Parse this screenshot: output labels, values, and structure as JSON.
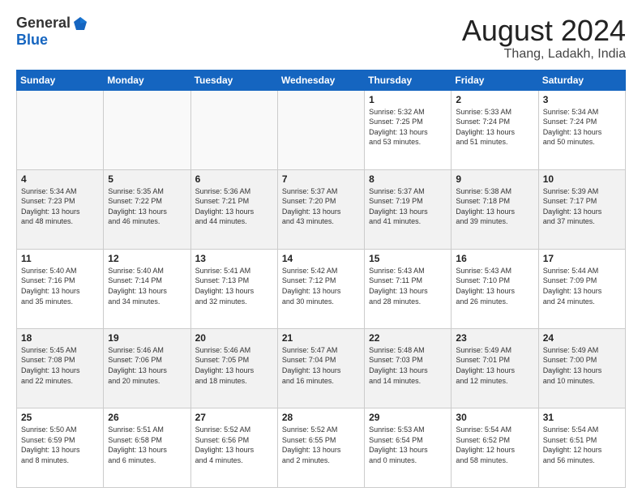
{
  "header": {
    "logo_general": "General",
    "logo_blue": "Blue",
    "month_title": "August 2024",
    "location": "Thang, Ladakh, India"
  },
  "weekdays": [
    "Sunday",
    "Monday",
    "Tuesday",
    "Wednesday",
    "Thursday",
    "Friday",
    "Saturday"
  ],
  "weeks": [
    [
      {
        "day": "",
        "info": ""
      },
      {
        "day": "",
        "info": ""
      },
      {
        "day": "",
        "info": ""
      },
      {
        "day": "",
        "info": ""
      },
      {
        "day": "1",
        "info": "Sunrise: 5:32 AM\nSunset: 7:25 PM\nDaylight: 13 hours\nand 53 minutes."
      },
      {
        "day": "2",
        "info": "Sunrise: 5:33 AM\nSunset: 7:24 PM\nDaylight: 13 hours\nand 51 minutes."
      },
      {
        "day": "3",
        "info": "Sunrise: 5:34 AM\nSunset: 7:24 PM\nDaylight: 13 hours\nand 50 minutes."
      }
    ],
    [
      {
        "day": "4",
        "info": "Sunrise: 5:34 AM\nSunset: 7:23 PM\nDaylight: 13 hours\nand 48 minutes."
      },
      {
        "day": "5",
        "info": "Sunrise: 5:35 AM\nSunset: 7:22 PM\nDaylight: 13 hours\nand 46 minutes."
      },
      {
        "day": "6",
        "info": "Sunrise: 5:36 AM\nSunset: 7:21 PM\nDaylight: 13 hours\nand 44 minutes."
      },
      {
        "day": "7",
        "info": "Sunrise: 5:37 AM\nSunset: 7:20 PM\nDaylight: 13 hours\nand 43 minutes."
      },
      {
        "day": "8",
        "info": "Sunrise: 5:37 AM\nSunset: 7:19 PM\nDaylight: 13 hours\nand 41 minutes."
      },
      {
        "day": "9",
        "info": "Sunrise: 5:38 AM\nSunset: 7:18 PM\nDaylight: 13 hours\nand 39 minutes."
      },
      {
        "day": "10",
        "info": "Sunrise: 5:39 AM\nSunset: 7:17 PM\nDaylight: 13 hours\nand 37 minutes."
      }
    ],
    [
      {
        "day": "11",
        "info": "Sunrise: 5:40 AM\nSunset: 7:16 PM\nDaylight: 13 hours\nand 35 minutes."
      },
      {
        "day": "12",
        "info": "Sunrise: 5:40 AM\nSunset: 7:14 PM\nDaylight: 13 hours\nand 34 minutes."
      },
      {
        "day": "13",
        "info": "Sunrise: 5:41 AM\nSunset: 7:13 PM\nDaylight: 13 hours\nand 32 minutes."
      },
      {
        "day": "14",
        "info": "Sunrise: 5:42 AM\nSunset: 7:12 PM\nDaylight: 13 hours\nand 30 minutes."
      },
      {
        "day": "15",
        "info": "Sunrise: 5:43 AM\nSunset: 7:11 PM\nDaylight: 13 hours\nand 28 minutes."
      },
      {
        "day": "16",
        "info": "Sunrise: 5:43 AM\nSunset: 7:10 PM\nDaylight: 13 hours\nand 26 minutes."
      },
      {
        "day": "17",
        "info": "Sunrise: 5:44 AM\nSunset: 7:09 PM\nDaylight: 13 hours\nand 24 minutes."
      }
    ],
    [
      {
        "day": "18",
        "info": "Sunrise: 5:45 AM\nSunset: 7:08 PM\nDaylight: 13 hours\nand 22 minutes."
      },
      {
        "day": "19",
        "info": "Sunrise: 5:46 AM\nSunset: 7:06 PM\nDaylight: 13 hours\nand 20 minutes."
      },
      {
        "day": "20",
        "info": "Sunrise: 5:46 AM\nSunset: 7:05 PM\nDaylight: 13 hours\nand 18 minutes."
      },
      {
        "day": "21",
        "info": "Sunrise: 5:47 AM\nSunset: 7:04 PM\nDaylight: 13 hours\nand 16 minutes."
      },
      {
        "day": "22",
        "info": "Sunrise: 5:48 AM\nSunset: 7:03 PM\nDaylight: 13 hours\nand 14 minutes."
      },
      {
        "day": "23",
        "info": "Sunrise: 5:49 AM\nSunset: 7:01 PM\nDaylight: 13 hours\nand 12 minutes."
      },
      {
        "day": "24",
        "info": "Sunrise: 5:49 AM\nSunset: 7:00 PM\nDaylight: 13 hours\nand 10 minutes."
      }
    ],
    [
      {
        "day": "25",
        "info": "Sunrise: 5:50 AM\nSunset: 6:59 PM\nDaylight: 13 hours\nand 8 minutes."
      },
      {
        "day": "26",
        "info": "Sunrise: 5:51 AM\nSunset: 6:58 PM\nDaylight: 13 hours\nand 6 minutes."
      },
      {
        "day": "27",
        "info": "Sunrise: 5:52 AM\nSunset: 6:56 PM\nDaylight: 13 hours\nand 4 minutes."
      },
      {
        "day": "28",
        "info": "Sunrise: 5:52 AM\nSunset: 6:55 PM\nDaylight: 13 hours\nand 2 minutes."
      },
      {
        "day": "29",
        "info": "Sunrise: 5:53 AM\nSunset: 6:54 PM\nDaylight: 13 hours\nand 0 minutes."
      },
      {
        "day": "30",
        "info": "Sunrise: 5:54 AM\nSunset: 6:52 PM\nDaylight: 12 hours\nand 58 minutes."
      },
      {
        "day": "31",
        "info": "Sunrise: 5:54 AM\nSunset: 6:51 PM\nDaylight: 12 hours\nand 56 minutes."
      }
    ]
  ]
}
